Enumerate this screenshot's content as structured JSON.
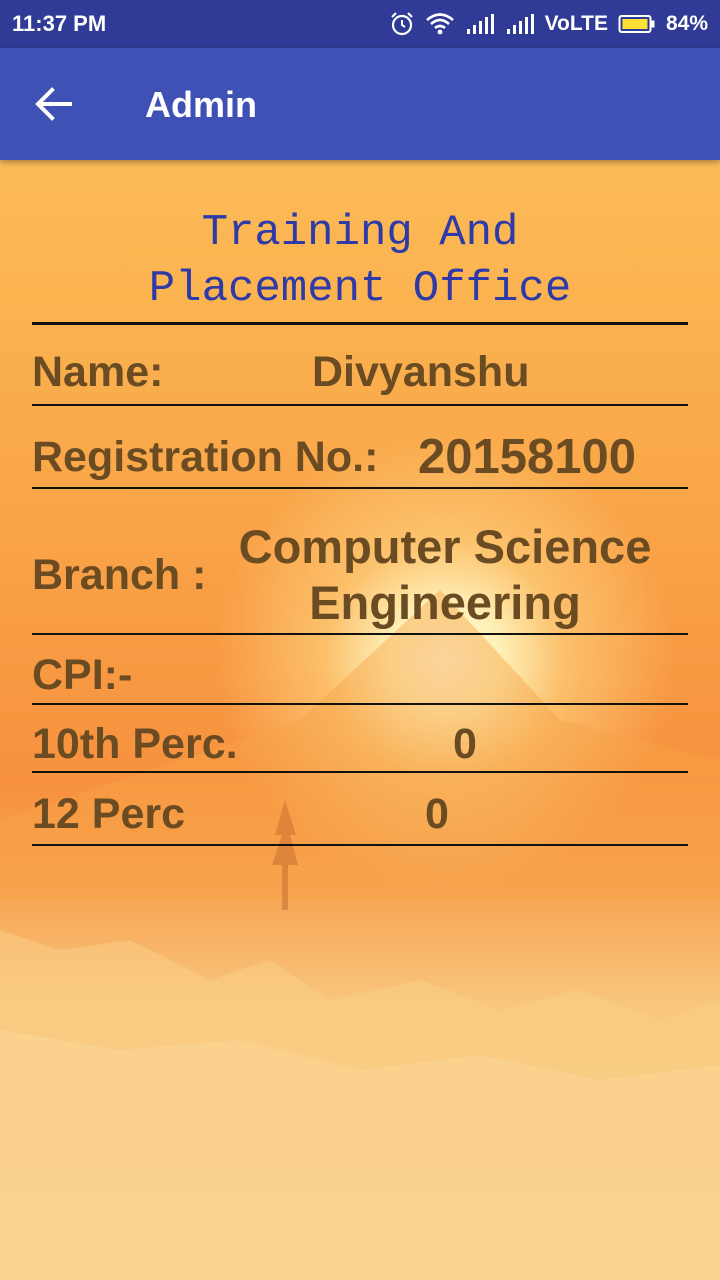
{
  "status_bar": {
    "time": "11:37 PM",
    "network": "VoLTE",
    "battery": "84%",
    "icons": [
      "alarm-icon",
      "wifi-icon",
      "signal-icon",
      "signal-icon",
      "battery-icon"
    ]
  },
  "app_bar": {
    "title": "Admin",
    "back_icon": "arrow-left-icon"
  },
  "header": {
    "line1": "Training And",
    "line2": "Placement Office"
  },
  "fields": {
    "name": {
      "label": "Name:",
      "value": "Divyanshu"
    },
    "registration": {
      "label": "Registration No.:",
      "value": "20158100"
    },
    "branch": {
      "label": "Branch :",
      "value_line1": "Computer Science",
      "value_line2": "Engineering"
    },
    "cpi": {
      "label": "CPI:-",
      "value": ""
    },
    "tenth": {
      "label": "10th Perc.",
      "value": "0"
    },
    "twelfth": {
      "label": "12 Perc",
      "value": "0"
    }
  },
  "colors": {
    "status_bar": "#2f3b96",
    "app_bar": "#3f51b5",
    "header_text": "#2e3aa8",
    "field_text": "#6b4b22"
  }
}
